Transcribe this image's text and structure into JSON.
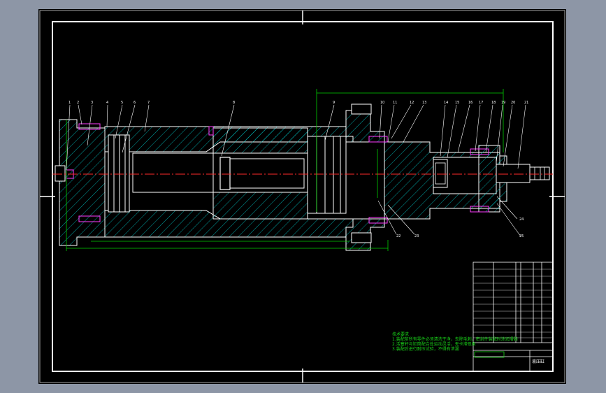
{
  "drawing": {
    "colors": {
      "background": "#000000",
      "frame": "#ffffff",
      "center_line": "#ff2a2a",
      "hatch": "#00c8c8",
      "dimension": "#00d000",
      "bolt": "#ff3cff",
      "leader": "#ffffff",
      "notes": "#19d419",
      "gray_bezel": "#8d96a6"
    },
    "part_callouts_top": [
      "1",
      "2",
      "3",
      "4",
      "5",
      "6",
      "7",
      "8",
      "9",
      "10",
      "11",
      "12",
      "13",
      "14",
      "15",
      "16",
      "17",
      "18",
      "19",
      "20",
      "21"
    ],
    "part_callouts_bottom": [
      "22",
      "23",
      "24",
      "25"
    ],
    "technical_notes": {
      "heading": "技术要求",
      "lines": [
        "1.装配前所有零件必须清洗干净，去除毛刺，密封件装配时涂润滑脂",
        "2.活塞杆与缸筒配合处运动灵活，无卡滞现象",
        "3.装配后进行耐压试验，不得有泄漏"
      ]
    },
    "title_block": {
      "drawing_name": "液压缸",
      "rows": 12
    }
  }
}
